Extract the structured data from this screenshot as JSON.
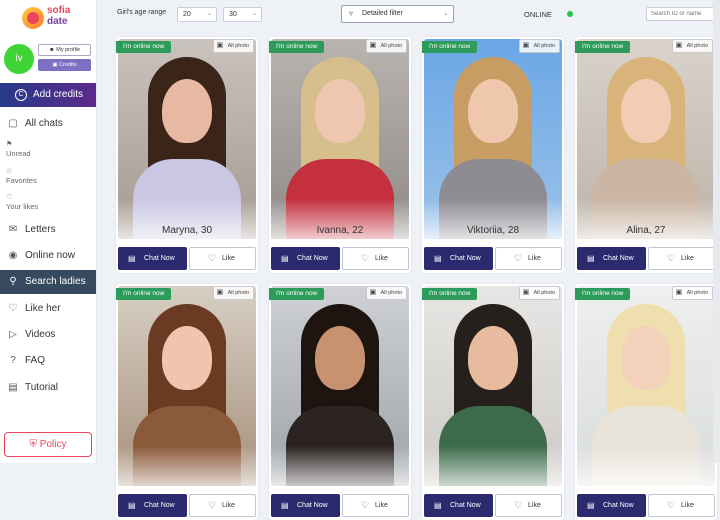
{
  "brand": {
    "line1": "sofia",
    "line2": "date"
  },
  "profile": {
    "avatar_initials": "iv",
    "my_profile_label": "My profile",
    "credits_label": "Credits"
  },
  "add_credits": {
    "label": "Add credits",
    "icon": "coin-icon"
  },
  "nav": {
    "all_chats": "All chats",
    "unread": "Unread",
    "favorites": "Favorites",
    "your_likes": "Your likes",
    "letters": "Letters",
    "online_now": "Online now",
    "search_ladies": "Search ladies",
    "like_her": "Like her",
    "videos": "Videos",
    "faq": "FAQ",
    "tutorial": "Tutorial"
  },
  "policy": {
    "label": "Policy"
  },
  "filters": {
    "age_label": "Girl's age range",
    "age_from": "20",
    "age_to": "30",
    "detailed_filter": "Detailed filter",
    "online_label": "ONLINE",
    "search_placeholder": "Search ID or name"
  },
  "colors": {
    "accent_dark": "#2b2a6e",
    "online_badge": "#2d9b5a",
    "active_nav": "#35495f",
    "brand_pink": "#e9445a"
  },
  "cards": [
    {
      "name": "Maryna, 30",
      "online": "I'm online now",
      "all_photo": "All photo",
      "chat": "Chat Now",
      "like": "Like"
    },
    {
      "name": "Ivanna, 22",
      "online": "I'm online now",
      "all_photo": "All photo",
      "chat": "Chat Now",
      "like": "Like"
    },
    {
      "name": "Viktoriia, 28",
      "online": "I'm online now",
      "all_photo": "All photo",
      "chat": "Chat Now",
      "like": "Like"
    },
    {
      "name": "Alina, 27",
      "online": "I'm online now",
      "all_photo": "All photo",
      "chat": "Chat Now",
      "like": "Like"
    },
    {
      "name": "",
      "online": "I'm online now",
      "all_photo": "All photo",
      "chat": "Chat Now",
      "like": "Like"
    },
    {
      "name": "",
      "online": "I'm online now",
      "all_photo": "All photo",
      "chat": "Chat Now",
      "like": "Like"
    },
    {
      "name": "",
      "online": "I'm online now",
      "all_photo": "All photo",
      "chat": "Chat Now",
      "like": "Like"
    },
    {
      "name": "",
      "online": "I'm online now",
      "all_photo": "All photo",
      "chat": "Chat Now",
      "like": "Like"
    }
  ]
}
